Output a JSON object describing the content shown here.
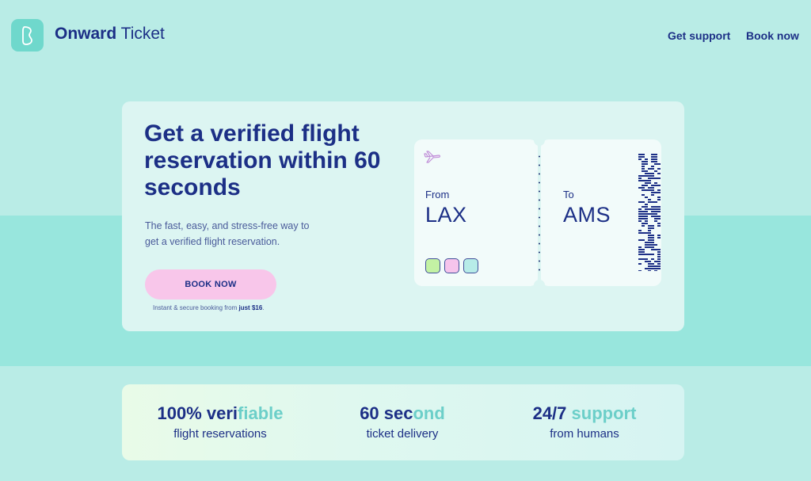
{
  "brand": {
    "bold": "Onward",
    "regular": " Ticket"
  },
  "nav": {
    "support": "Get support",
    "book": "Book now"
  },
  "hero": {
    "title": "Get a verified flight reservation within 60 seconds",
    "subtitle": "The fast, easy, and stress-free way to get a verified flight reservation.",
    "cta": "BOOK NOW",
    "note_prefix": "Instant & secure booking from ",
    "note_price": "just $16",
    "note_suffix": "."
  },
  "ticket": {
    "from_label": "From",
    "from_code": "LAX",
    "to_label": "To",
    "to_code": "AMS",
    "icon": "airplane-icon",
    "swatches": [
      "#c3f2a4",
      "#f6c4ec",
      "#b7ece8"
    ]
  },
  "stats": [
    {
      "big_a": "100% veri",
      "big_b": "fiable",
      "small": "flight reservations"
    },
    {
      "big_a": "60 sec",
      "big_b": "ond",
      "small": "ticket delivery"
    },
    {
      "big_a": "24/7 ",
      "big_b": "support",
      "small": "from humans"
    }
  ],
  "colors": {
    "background": "#b9ece6",
    "band": "#98e6dd",
    "navy": "#1c2f86",
    "cta": "#f8c6ea",
    "accent_teal": "#6ccfc9"
  }
}
